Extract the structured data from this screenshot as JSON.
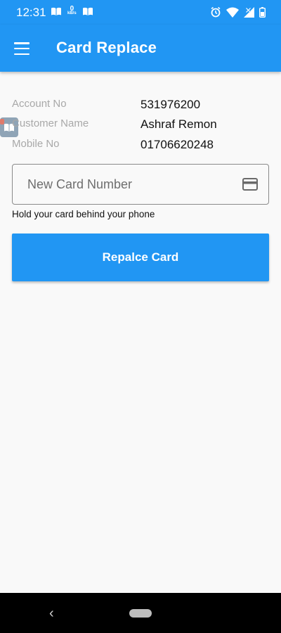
{
  "status_bar": {
    "time": "12:31",
    "speed_value": "0",
    "speed_unit": "kB/s",
    "icons": [
      "book-icon",
      "kbs-indicator",
      "book-icon",
      "alarm-icon",
      "wifi-icon",
      "signal-icon",
      "battery-icon"
    ]
  },
  "app_bar": {
    "title": "Card Replace",
    "menu_icon": "hamburger-menu-icon"
  },
  "account_info": {
    "rows": [
      {
        "label": "Account No",
        "value": "531976200"
      },
      {
        "label": "Customer Name",
        "value": "Ashraf Remon"
      },
      {
        "label": "Mobile No",
        "value": "01706620248"
      }
    ]
  },
  "card_input": {
    "placeholder": "New Card Number",
    "value": "",
    "icon": "credit-card-icon"
  },
  "hint_text": "Hold your card behind your phone",
  "replace_button": {
    "label": "Repalce Card"
  },
  "nav_bar": {
    "back_icon": "back-chevron-icon",
    "home_icon": "home-pill-icon"
  },
  "colors": {
    "primary": "#2196f3",
    "background": "#f9f9f9",
    "label_gray": "#a8a8a8"
  }
}
